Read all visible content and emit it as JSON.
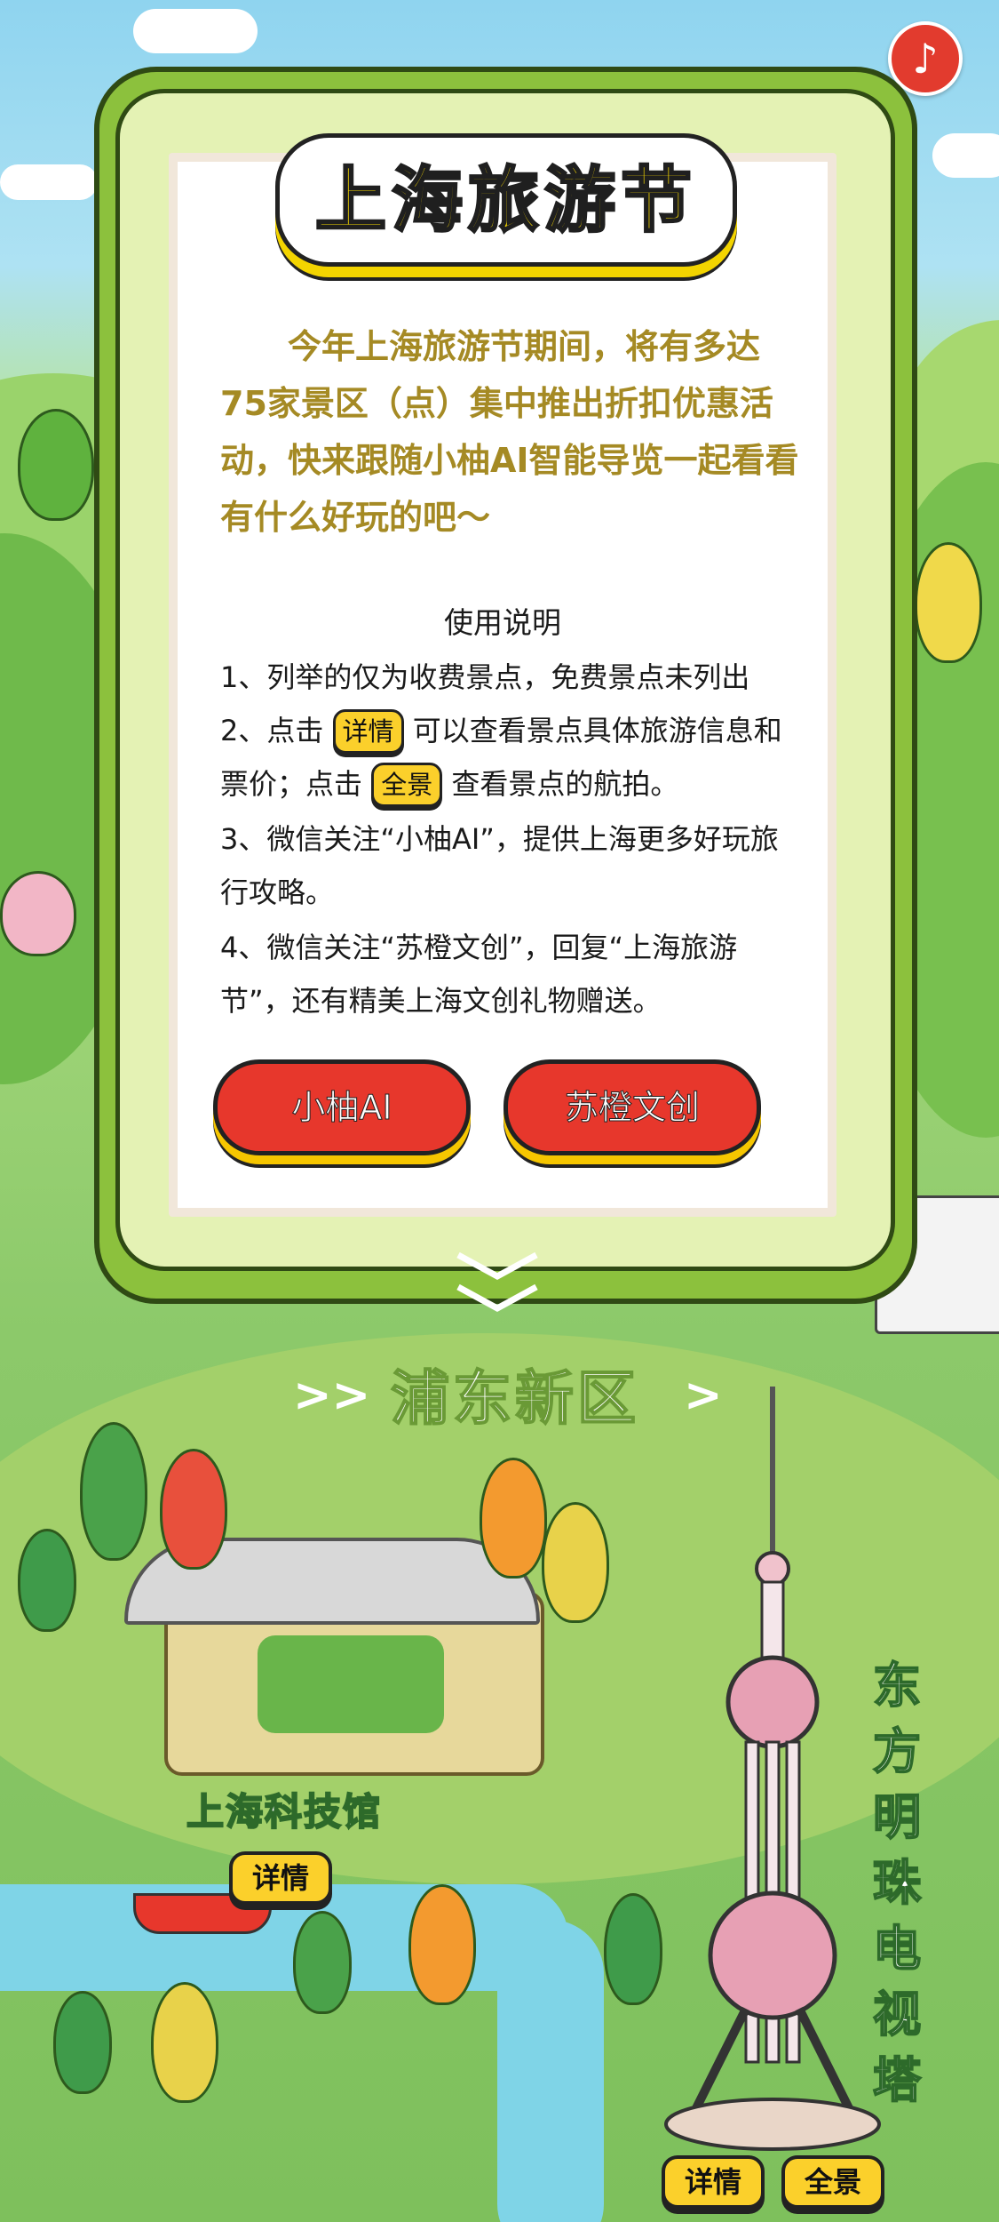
{
  "header": {
    "music_icon": "music-note-icon",
    "music_glyph": "♪"
  },
  "card": {
    "title": "上海旅游节",
    "intro": "今年上海旅游节期间，将有多达75家景区（点）集中推出折扣优惠活动，快来跟随小柚AI智能导览一起看看有什么好玩的吧～",
    "instructions_title": "使用说明",
    "item1": "1、列举的仅为收费景点，免费景点未列出",
    "item2_prefix": "2、点击",
    "item2_chip_detail": "详情",
    "item2_middle_a": "可以查看景点具体旅游信",
    "item2_middle_b": "息和票价；点击",
    "item2_chip_pano": "全景",
    "item2_suffix": "查看景点的航拍。",
    "item3": "3、微信关注“小柚AI”，提供上海更多好玩旅行攻略。",
    "item4": "4、微信关注“苏橙文创”，回复“上海旅游节”，还有精美上海文创礼物赠送。",
    "button_left": "小柚AI",
    "button_right": "苏橙文创"
  },
  "scroll_hint_icon": "double-chevron-down-icon",
  "section": {
    "chevrons_left": ">>",
    "title": "浦东新区",
    "chevrons_right": ">"
  },
  "attractions": [
    {
      "name": "上海科技馆",
      "detail": "详情"
    },
    {
      "name": "东方明珠电视塔",
      "detail": "详情",
      "pano": "全景"
    }
  ],
  "colors": {
    "sky": "#8fd4ef",
    "grass": "#8cc96a",
    "card_green": "#8cc13d",
    "title_yellow": "#f6d800",
    "intro_text": "#a58a24",
    "button_red": "#e7372c",
    "chip_yellow": "#fbd02b"
  }
}
